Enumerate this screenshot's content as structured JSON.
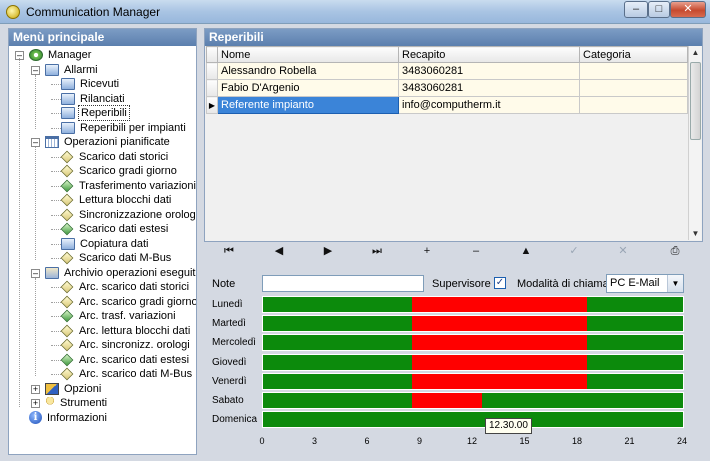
{
  "window": {
    "title": "Communication Manager",
    "controls": {
      "minimize": "–",
      "maximize": "□",
      "close": "✕"
    }
  },
  "sidebar": {
    "header": "Menù principale",
    "root": "Manager",
    "groups": [
      {
        "label": "Allarmi",
        "icon": "folder-icon",
        "items": [
          "Ricevuti",
          "Rilanciati",
          "Reperibili",
          "Reperibili per impianti"
        ],
        "selected": 2
      },
      {
        "label": "Operazioni pianificate",
        "icon": "calendar-icon",
        "items": [
          "Scarico dati storici",
          "Scarico gradi giorno",
          "Trasferimento variazioni",
          "Lettura blocchi dati",
          "Sincronizzazione orologi",
          "Scarico dati estesi",
          "Copiatura dati",
          "Scarico dati M-Bus"
        ]
      },
      {
        "label": "Archivio operazioni eseguite",
        "icon": "archive-folder-icon",
        "items": [
          "Arc. scarico dati storici",
          "Arc. scarico gradi giorno",
          "Arc. trasf. variazioni",
          "Arc. lettura blocchi dati",
          "Arc. sincronizz. orologi",
          "Arc. scarico dati estesi",
          "Arc. scarico dati M-Bus"
        ]
      }
    ],
    "extra": [
      "Opzioni",
      "Strumenti"
    ],
    "info": "Informazioni"
  },
  "reperibili": {
    "header": "Reperibili",
    "columns": [
      "Nome",
      "Recapito",
      "Categoria"
    ],
    "rows": [
      {
        "nome": "Alessandro Robella",
        "recapito": "3483060281",
        "categoria": ""
      },
      {
        "nome": "Fabio D'Argenio",
        "recapito": "3483060281",
        "categoria": ""
      },
      {
        "nome": "Referente impianto",
        "recapito": "info@computherm.it",
        "categoria": ""
      }
    ],
    "current_row": 2
  },
  "navigator": {
    "buttons": [
      {
        "name": "first",
        "glyph": "⏮",
        "enabled": true
      },
      {
        "name": "prior",
        "glyph": "◀",
        "enabled": true
      },
      {
        "name": "next",
        "glyph": "▶",
        "enabled": true
      },
      {
        "name": "last",
        "glyph": "⏭",
        "enabled": true
      },
      {
        "name": "insert",
        "glyph": "+",
        "enabled": true
      },
      {
        "name": "delete",
        "glyph": "–",
        "enabled": true
      },
      {
        "name": "edit",
        "glyph": "▲",
        "enabled": true
      },
      {
        "name": "post",
        "glyph": "✓",
        "enabled": false
      },
      {
        "name": "cancel",
        "glyph": "✕",
        "enabled": false
      },
      {
        "name": "refresh",
        "glyph": "⎙",
        "enabled": true
      }
    ]
  },
  "schedule": {
    "note_label": "Note",
    "note_value": "",
    "supervisore_label": "Supervisore",
    "supervisore_checked": true,
    "modalita_label": "Modalità di chiamata",
    "modalita_value": "PC E-Mail",
    "colors": {
      "available": "#0c8a0c",
      "unavailable": "#ff0000"
    },
    "days": [
      {
        "name": "Lunedì",
        "red_from": 8.5,
        "red_to": 18.5
      },
      {
        "name": "Martedì",
        "red_from": 8.5,
        "red_to": 18.5
      },
      {
        "name": "Mercoledì",
        "red_from": 8.5,
        "red_to": 18.5
      },
      {
        "name": "Giovedì",
        "red_from": 8.5,
        "red_to": 18.5
      },
      {
        "name": "Venerdì",
        "red_from": 8.5,
        "red_to": 18.5
      },
      {
        "name": "Sabato",
        "red_from": 8.5,
        "red_to": 12.5
      },
      {
        "name": "Domenica",
        "red_from": null,
        "red_to": null
      }
    ],
    "axis_ticks": [
      "0",
      "3",
      "6",
      "9",
      "12",
      "15",
      "18",
      "21",
      "24"
    ],
    "axis_max": 24,
    "tooltip": "12.30.00"
  }
}
